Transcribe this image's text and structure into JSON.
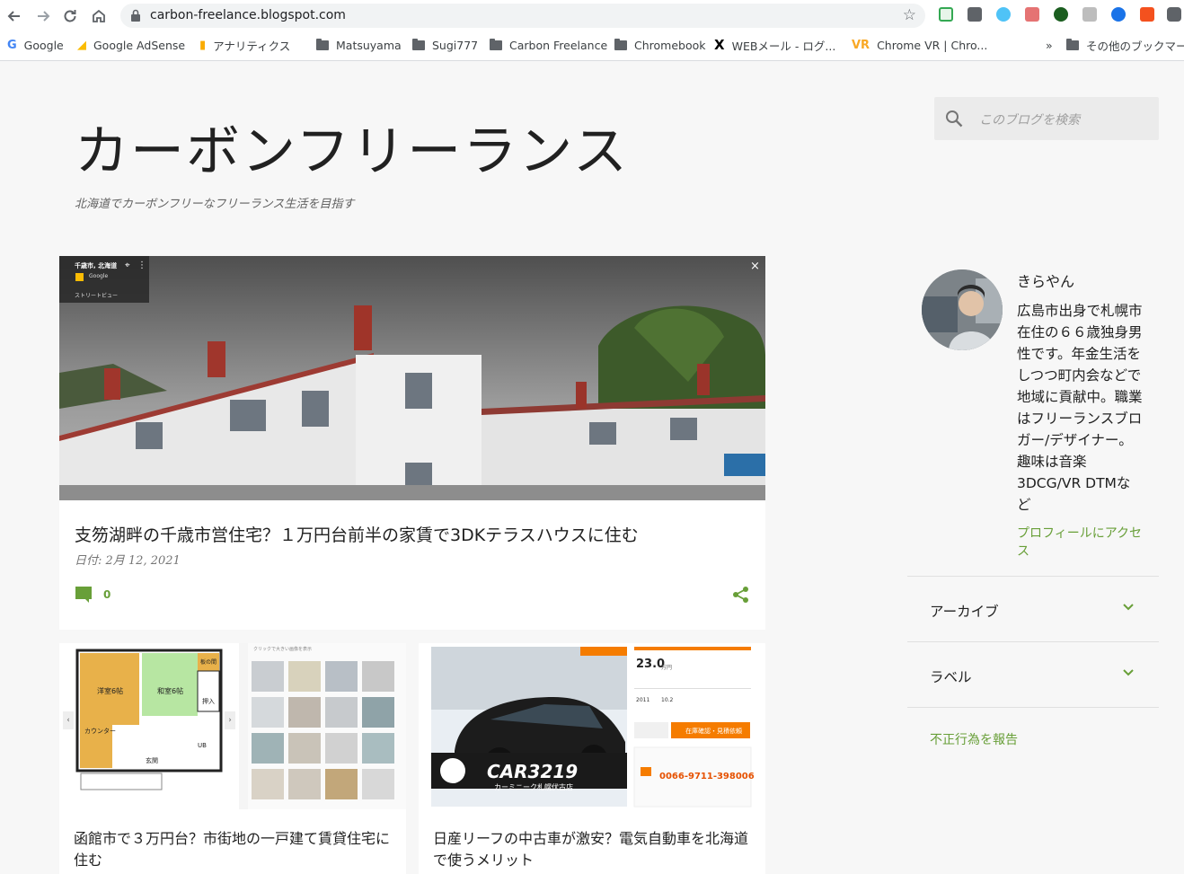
{
  "browser": {
    "url": "carbon-freelance.blogspot.com",
    "bookmarks": [
      {
        "label": "Google",
        "icon": "google-icon"
      },
      {
        "label": "Google AdSense",
        "icon": "adsense-icon"
      },
      {
        "label": "アナリティクス",
        "icon": "analytics-icon"
      },
      {
        "label": "Matsuyama",
        "icon": "folder-icon"
      },
      {
        "label": "Sugi777",
        "icon": "folder-icon"
      },
      {
        "label": "Carbon Freelance",
        "icon": "folder-icon"
      },
      {
        "label": "Chromebook",
        "icon": "folder-icon"
      },
      {
        "label": "WEBメール - ログ...",
        "icon": "x-logo-icon"
      },
      {
        "label": "Chrome VR | Chro...",
        "icon": "vr-icon"
      }
    ],
    "more_label": "»",
    "other_bookmarks": "その他のブックマー"
  },
  "blog": {
    "title": "カーボンフリーランス",
    "description": "北海道でカーボンフリーなフリーランス生活を目指す",
    "search_placeholder": "このブログを検索"
  },
  "featured_post": {
    "title": "支笏湖畔の千歳市営住宅？１万円台前半の家賃で3DKテラスハウスに住む",
    "date": "日付: 2月 12, 2021",
    "comments": "0",
    "overlay": {
      "place": "千歳市, 北海道",
      "brand": "Google",
      "mode": "ストリートビュー"
    }
  },
  "posts": [
    {
      "title": "函館市で３万円台？市街地の一戸建て賃貸住宅に住む"
    },
    {
      "title": "日産リーフの中古車が激安？電気自動車を北海道で使うメリット"
    }
  ],
  "thumb_floorplan": {
    "rooms": [
      "洋室6帖",
      "和室6帖",
      "押入",
      "カウンター",
      "玄関",
      "UB",
      "板の間"
    ],
    "header": "クリックで大きい画像を表示"
  },
  "thumb_car": {
    "logo": "CAR3219",
    "shop": "カーミニーク札幌伏古店",
    "price": "23.0",
    "price_unit": "万円",
    "year": "2011",
    "mileage": "10.2",
    "phone": "0066-9711-398006",
    "inquiry": "在庫確認・見積依頼"
  },
  "profile": {
    "name": "きらやん",
    "bio": "広島市出身で札幌市在住の６６歳独身男性です。年金生活をしつつ町内会などで地域に貢献中。職業はフリーランスブロガー/デザイナー。趣味は音楽 3DCG/VR DTMなど",
    "link": "プロフィールにアクセス"
  },
  "widgets": {
    "archive": "アーカイブ",
    "labels": "ラベル"
  },
  "report": "不正行為を報告",
  "colors": {
    "accent": "#689f38",
    "background": "#f7f7f7"
  }
}
